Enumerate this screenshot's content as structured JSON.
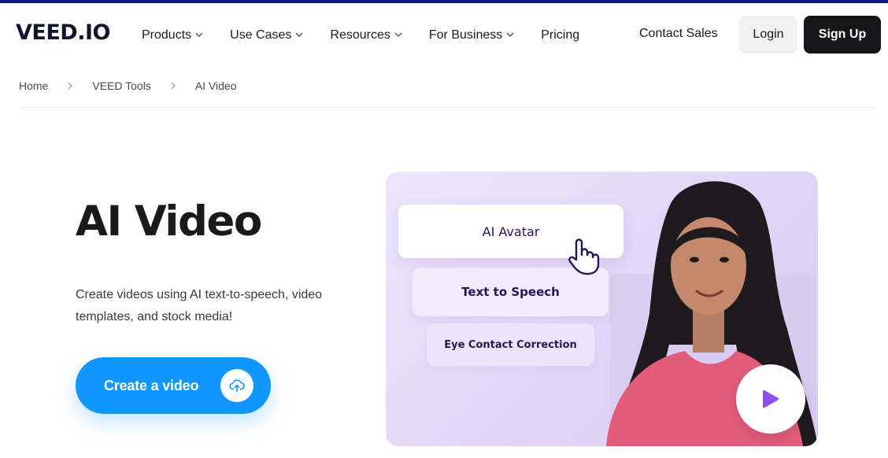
{
  "header": {
    "logo": "VEED.IO",
    "nav": [
      {
        "label": "Products",
        "has_dropdown": true
      },
      {
        "label": "Use Cases",
        "has_dropdown": true
      },
      {
        "label": "Resources",
        "has_dropdown": true
      },
      {
        "label": "For Business",
        "has_dropdown": true
      },
      {
        "label": "Pricing",
        "has_dropdown": false
      }
    ],
    "contact_sales": "Contact Sales",
    "login": "Login",
    "signup": "Sign Up"
  },
  "breadcrumb": [
    "Home",
    "VEED Tools",
    "AI Video"
  ],
  "hero": {
    "title": "AI Video",
    "subtitle": "Create videos using AI text-to-speech, video templates, and stock media!",
    "cta_label": "Create a video",
    "cta_icon": "upload-cloud-icon"
  },
  "preview": {
    "cards": [
      "AI Avatar",
      "Text to Speech",
      "Eye Contact Correction"
    ],
    "play_icon": "play-icon",
    "cursor_icon": "hand-pointer-icon"
  },
  "colors": {
    "accent": "#0f96ff",
    "dark": "#17171a",
    "topline": "#101a7a",
    "play": "#8b4cf0",
    "card_text": "#2a1458"
  }
}
